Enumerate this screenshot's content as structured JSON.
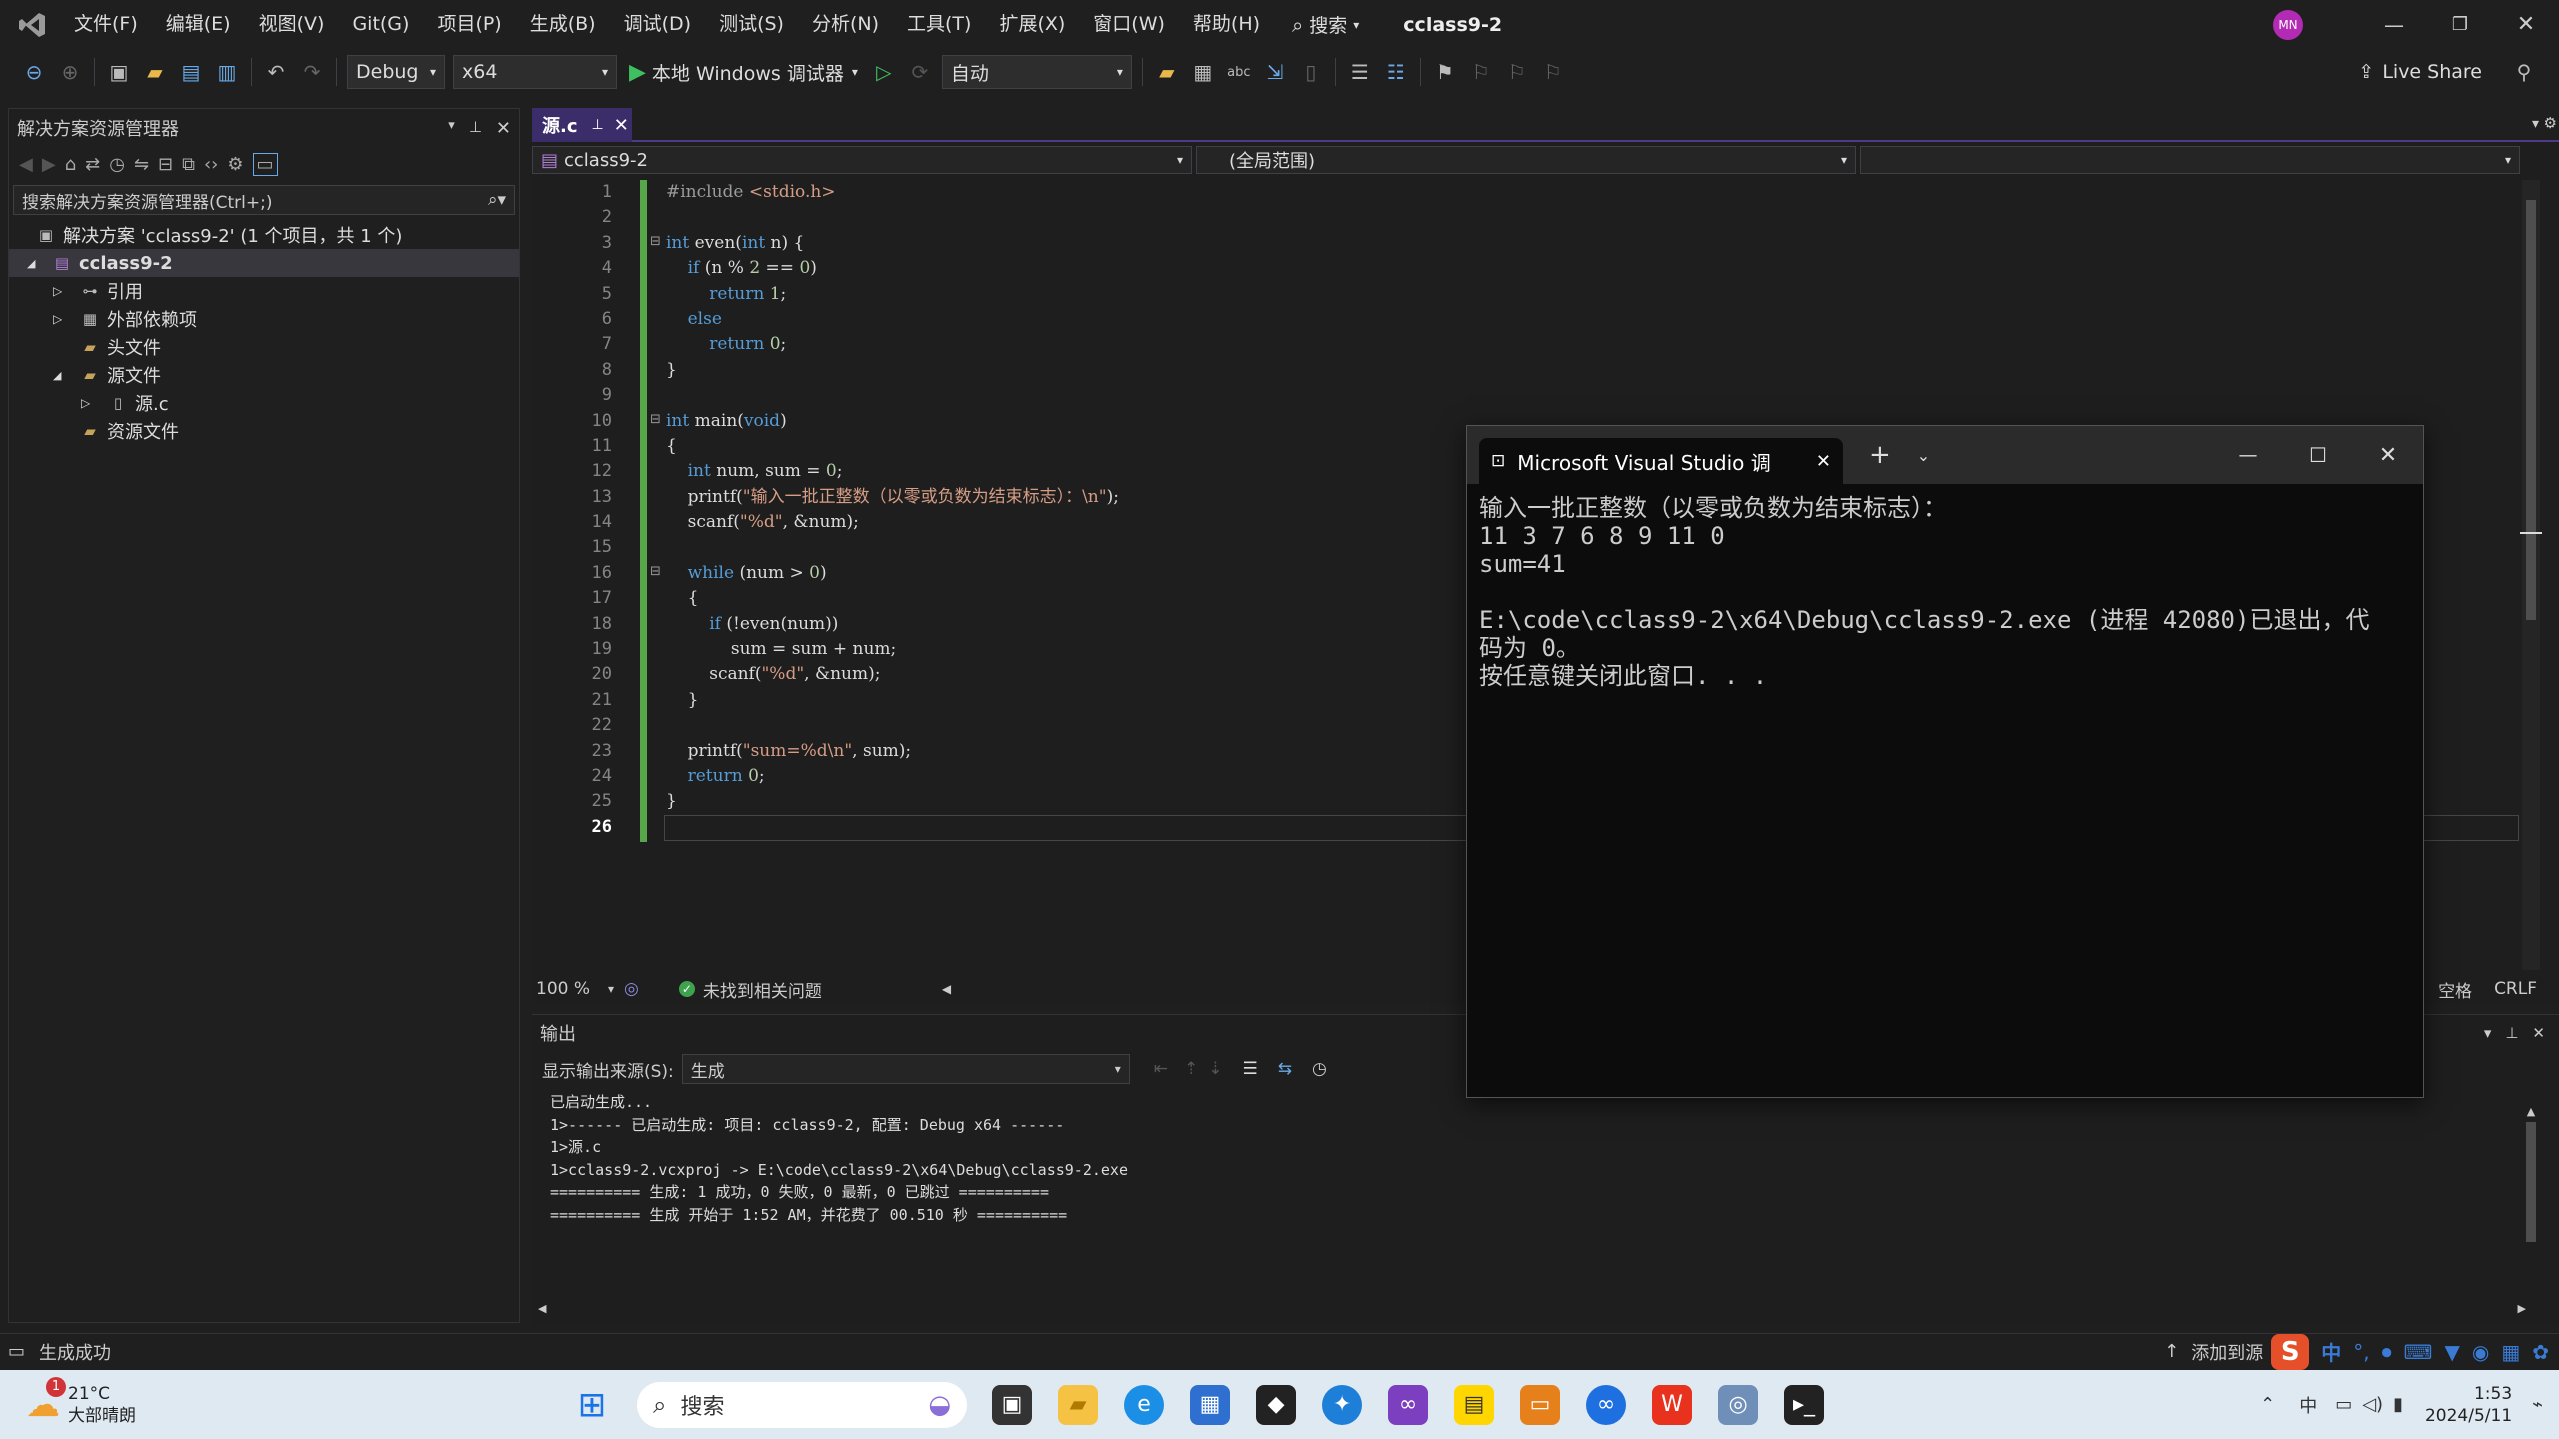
{
  "menu": [
    "文件(F)",
    "编辑(E)",
    "视图(V)",
    "Git(G)",
    "项目(P)",
    "生成(B)",
    "调试(D)",
    "测试(S)",
    "分析(N)",
    "工具(T)",
    "扩展(X)",
    "窗口(W)",
    "帮助(H)"
  ],
  "search_label": "搜索",
  "solution_name": "cclass9-2",
  "user_initials": "MN",
  "toolbar": {
    "config": "Debug",
    "platform": "x64",
    "run_label": "本地 Windows 调试器",
    "auto": "自动",
    "live_share": "Live Share"
  },
  "solution_explorer": {
    "title": "解决方案资源管理器",
    "search_placeholder": "搜索解决方案资源管理器(Ctrl+;)",
    "items": [
      "解决方案 'cclass9-2' (1 个项目，共 1 个)",
      "cclass9-2",
      "引用",
      "外部依赖项",
      "头文件",
      "源文件",
      "源.c",
      "资源文件"
    ]
  },
  "editor": {
    "tab": "源.c",
    "nav_project": "cclass9-2",
    "nav_scope": "(全局范围)",
    "zoom": "100 %",
    "issues": "未找到相关问题",
    "spaces": "空格",
    "eol": "CRLF",
    "line_numbers": [
      "1",
      "2",
      "3",
      "4",
      "5",
      "6",
      "7",
      "8",
      "9",
      "10",
      "11",
      "12",
      "13",
      "14",
      "15",
      "16",
      "17",
      "18",
      "19",
      "20",
      "21",
      "22",
      "23",
      "24",
      "25",
      "26"
    ]
  },
  "output": {
    "title": "输出",
    "source_label": "显示输出来源(S):",
    "source_value": "生成",
    "lines": [
      "已启动生成...",
      "1>------ 已启动生成: 项目: cclass9-2, 配置: Debug x64 ------",
      "1>源.c",
      "1>cclass9-2.vcxproj -> E:\\code\\cclass9-2\\x64\\Debug\\cclass9-2.exe",
      "========== 生成: 1 成功，0 失败，0 最新，0 已跳过 ==========",
      "========== 生成 开始于 1:52 AM，并花费了 00.510 秒 =========="
    ]
  },
  "console": {
    "title": "Microsoft Visual Studio 调",
    "lines": [
      "输入一批正整数（以零或负数为结束标志）：",
      "11 3 7 6 8 9 11 0",
      "sum=41",
      "",
      "E:\\code\\cclass9-2\\x64\\Debug\\cclass9-2.exe (进程 42080)已退出，代",
      "码为 0。",
      "按任意键关闭此窗口. . ."
    ]
  },
  "status": {
    "build": "生成成功",
    "add_source": "添加到源"
  },
  "taskbar": {
    "weather_temp": "21°C",
    "weather_desc": "大部晴朗",
    "weather_badge": "1",
    "search": "搜索",
    "time": "1:53",
    "date": "2024/5/11",
    "ime": "中"
  }
}
